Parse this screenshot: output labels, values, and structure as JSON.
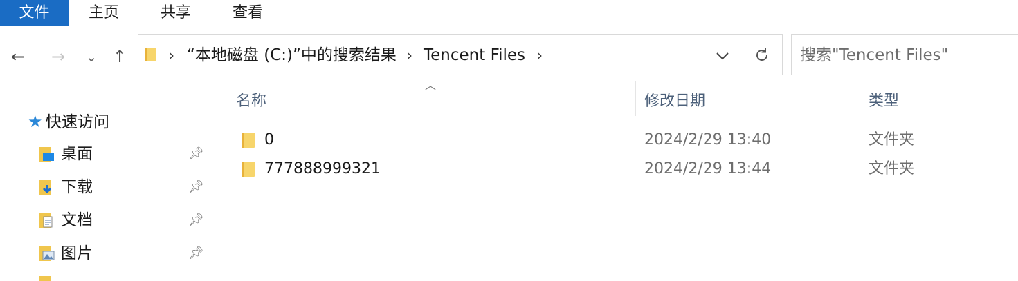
{
  "ribbon": {
    "tabs": [
      {
        "label": "文件",
        "active": true
      },
      {
        "label": "主页"
      },
      {
        "label": "共享"
      },
      {
        "label": "查看"
      }
    ],
    "accent": "#1a6cc4"
  },
  "nav_buttons": {
    "back": "←",
    "forward": "→",
    "recent": "⌄",
    "up": "↑"
  },
  "address": {
    "crumbs": [
      "“本地磁盘 (C:)”中的搜索结果",
      "Tencent Files"
    ],
    "separator": "›",
    "dropdown_icon": "chevron-down-icon",
    "refresh_icon": "refresh-icon"
  },
  "search": {
    "placeholder": "搜索\"Tencent Files\""
  },
  "navpane": {
    "quick_access": "快速访问",
    "items": [
      {
        "label": "桌面",
        "icon": "desktop-folder-icon",
        "pinned": true
      },
      {
        "label": "下载",
        "icon": "downloads-folder-icon",
        "pinned": true
      },
      {
        "label": "文档",
        "icon": "documents-folder-icon",
        "pinned": true
      },
      {
        "label": "图片",
        "icon": "pictures-folder-icon",
        "pinned": true
      }
    ]
  },
  "filelist": {
    "columns": {
      "name": "名称",
      "date": "修改日期",
      "type": "类型"
    },
    "rows": [
      {
        "name": "0",
        "date": "2024/2/29 13:40",
        "type": "文件夹"
      },
      {
        "name": "777888999321",
        "date": "2024/2/29 13:44",
        "type": "文件夹"
      }
    ]
  }
}
